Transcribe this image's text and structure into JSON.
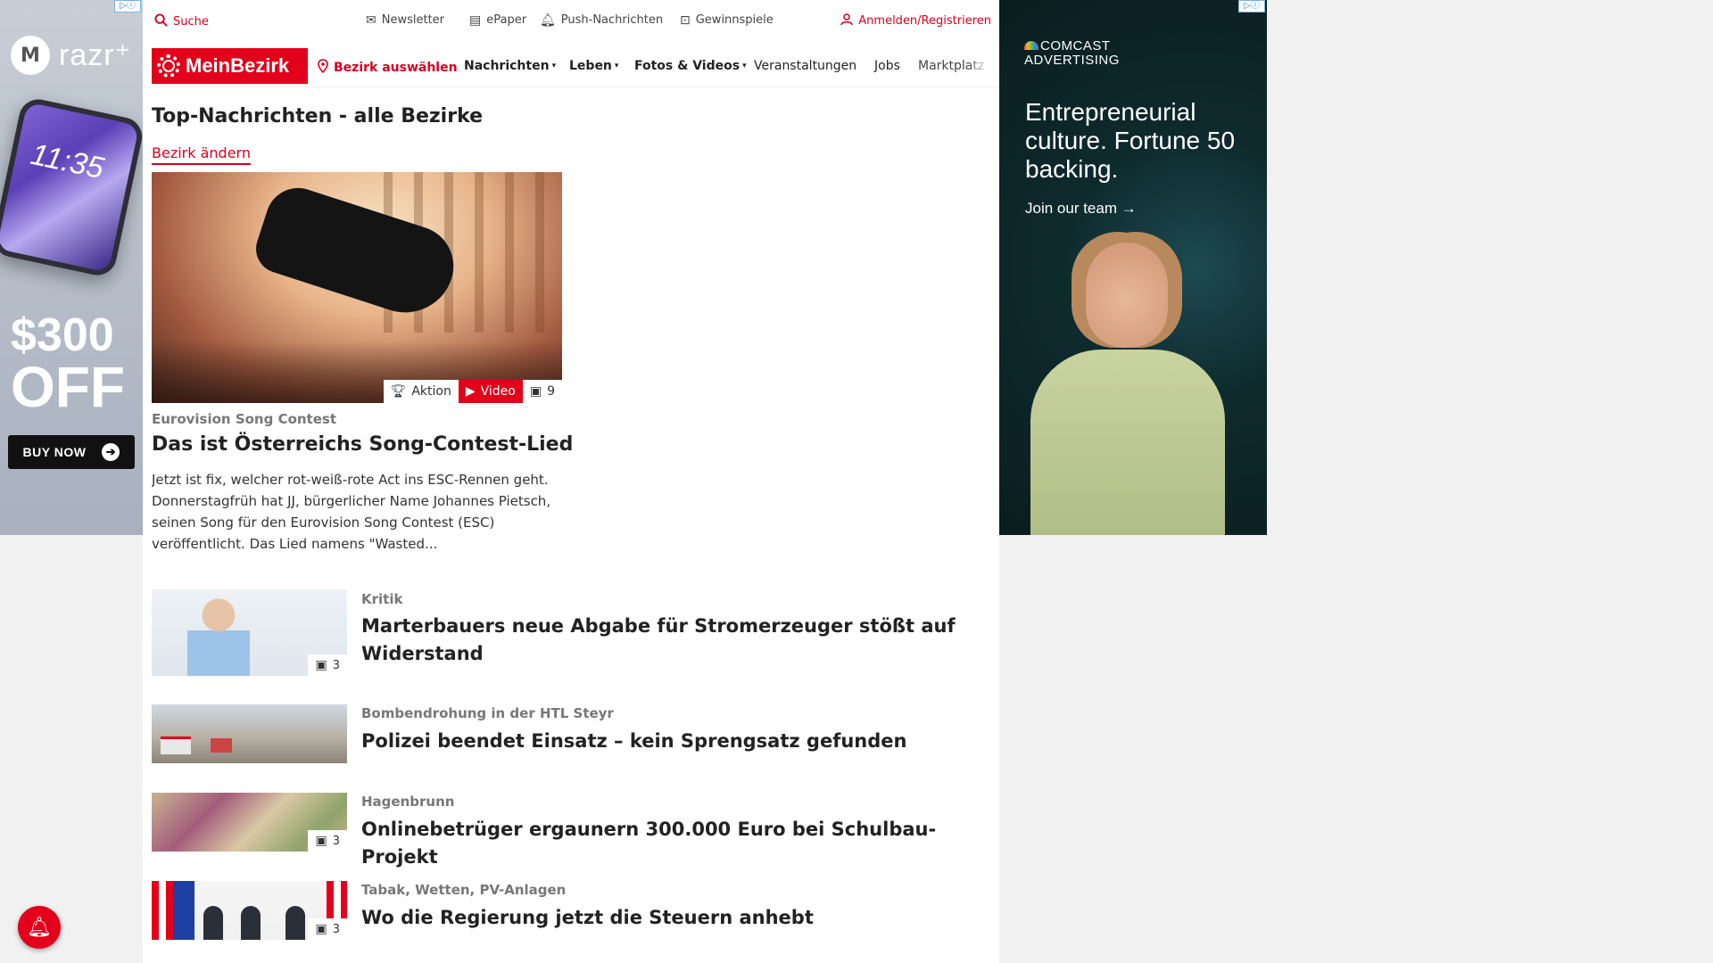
{
  "ad_left": {
    "ad_choice": "▷ⓘ",
    "brand": "razr⁺",
    "phone_time": "11:35",
    "offer_amount": "$300",
    "offer_off": "OFF",
    "cta": "BUY NOW"
  },
  "ad_right": {
    "ad_choice": "▷ⓘ",
    "logo_line1": "COMCAST",
    "logo_line2": "ADVERTISING",
    "headline": "Entrepreneurial culture. Fortune 50 backing.",
    "cta": "Join our team →"
  },
  "topbar": {
    "search": "Suche",
    "newsletter": "Newsletter",
    "epaper": "ePaper",
    "push": "Push-Nachrichten",
    "gewinnspiele": "Gewinnspiele",
    "signin": "Anmelden/Registrieren"
  },
  "nav": {
    "logo": "MeinBezirk",
    "bezirk": "Bezirk auswählen",
    "items": [
      "Nachrichten",
      "Leben",
      "Fotos & Videos",
      "Veranstaltungen",
      "Jobs",
      "Marktplatz"
    ]
  },
  "page": {
    "title": "Top-Nachrichten - alle Bezirke",
    "change_link": "Bezirk ändern"
  },
  "hero": {
    "badge_aktion": "Aktion",
    "badge_video": "Video",
    "badge_count": "9",
    "kicker": "Eurovision Song Contest",
    "title": "Das ist Österreichs Song-Contest-Lied",
    "teaser": "Jetzt ist fix, welcher rot-weiß-rote Act ins ESC-Rennen geht. Donnerstagfrüh hat JJ, bürgerlicher Name Johannes Pietsch, seinen Song für den Eurovision Song Contest (ESC) veröffentlicht. Das Lied namens \"Wasted..."
  },
  "articles": [
    {
      "kicker": "Kritik",
      "title": "Marterbauers neue Abgabe für Stromerzeuger stößt auf Widerstand",
      "count": "3"
    },
    {
      "kicker": "Bombendrohung in der HTL Steyr",
      "title": "Polizei beendet Einsatz – kein Sprengsatz gefunden",
      "count": ""
    },
    {
      "kicker": "Hagenbrunn",
      "title": "Onlinebetrüger ergaunern 300.000 Euro bei Schulbau-Projekt",
      "count": "3"
    },
    {
      "kicker": "Tabak, Wetten, PV-Anlagen",
      "title": "Wo die Regierung jetzt die Steuern anhebt",
      "count": "3"
    }
  ],
  "colors": {
    "brand_red": "#e2001a",
    "link_red": "#d8001e"
  }
}
